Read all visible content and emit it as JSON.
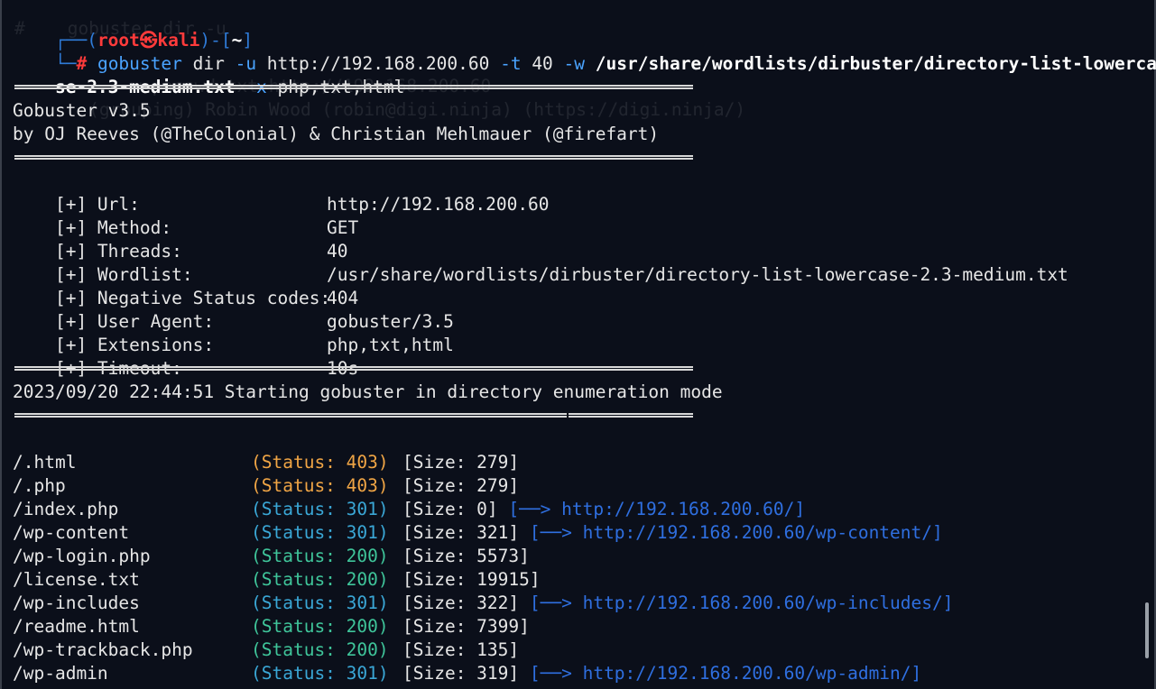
{
  "prompt": {
    "frame_top_open": "┌──(",
    "user": "root㉿kali",
    "frame_mid": ")-[",
    "cwd": "~",
    "frame_top_close": "]",
    "frame_bottom": "└─",
    "hash": "#",
    "command_name": "gobuster",
    "subcommand": " dir ",
    "flag_u": "-u",
    "url_arg": " http://192.168.200.60 ",
    "flag_t": "-t",
    "threads_arg": " 40 ",
    "flag_w": "-w",
    "wordlist_arg_part1": " /usr/share/wordlists/dirbuster/directory-list-lowerca",
    "wordlist_arg_part2": "se-2.3-medium.txt",
    "flag_x": " -x",
    "ext_arg": " php,txt,html"
  },
  "ghost_text": {
    "line1": "#    gobuster dir -u",
    "line2": "          -w passwd.txt http://192.168.200.60",
    "line3": "       (grouping) Robin Wood (robin@digi.ninja) (https://digi.ninja/)"
  },
  "banner": {
    "title": "Gobuster v3.5",
    "credits": "by OJ Reeves (@TheColonial) & Christian Mehlmauer (@firefart)"
  },
  "config": [
    {
      "key": "[+] Url:",
      "value": "http://192.168.200.60"
    },
    {
      "key": "[+] Method:",
      "value": "GET"
    },
    {
      "key": "[+] Threads:",
      "value": "40"
    },
    {
      "key": "[+] Wordlist:",
      "value": "/usr/share/wordlists/dirbuster/directory-list-lowercase-2.3-medium.txt"
    },
    {
      "key": "[+] Negative Status codes:",
      "value": "404"
    },
    {
      "key": "[+] User Agent:",
      "value": "gobuster/3.5"
    },
    {
      "key": "[+] Extensions:",
      "value": "php,txt,html"
    },
    {
      "key": "[+] Timeout:",
      "value": "10s"
    }
  ],
  "start_message": "2023/09/20 22:44:51 Starting gobuster in directory enumeration mode",
  "results": [
    {
      "path": "/.html",
      "status": "(Status: 403)",
      "size": "[Size: 279]",
      "redirect": ""
    },
    {
      "path": "/.php",
      "status": "(Status: 403)",
      "size": "[Size: 279]",
      "redirect": ""
    },
    {
      "path": "/index.php",
      "status": "(Status: 301)",
      "size": "[Size: 0]",
      "redirect": "[──> http://192.168.200.60/]"
    },
    {
      "path": "/wp-content",
      "status": "(Status: 301)",
      "size": "[Size: 321]",
      "redirect": "[──> http://192.168.200.60/wp-content/]"
    },
    {
      "path": "/wp-login.php",
      "status": "(Status: 200)",
      "size": "[Size: 5573]",
      "redirect": ""
    },
    {
      "path": "/license.txt",
      "status": "(Status: 200)",
      "size": "[Size: 19915]",
      "redirect": ""
    },
    {
      "path": "/wp-includes",
      "status": "(Status: 301)",
      "size": "[Size: 322]",
      "redirect": "[──> http://192.168.200.60/wp-includes/]"
    },
    {
      "path": "/readme.html",
      "status": "(Status: 200)",
      "size": "[Size: 7399]",
      "redirect": ""
    },
    {
      "path": "/wp-trackback.php",
      "status": "(Status: 200)",
      "size": "[Size: 135]",
      "redirect": ""
    },
    {
      "path": "/wp-admin",
      "status": "(Status: 301)",
      "size": "[Size: 319]",
      "redirect": "[──> http://192.168.200.60/wp-admin/]"
    }
  ],
  "colors": {
    "background": "#0b0f1a",
    "status_403": "#f0a545",
    "status_301": "#3aa7d6",
    "status_200": "#3fc59a",
    "redirect": "#2f6fe0",
    "prompt_user": "#ff3b3b",
    "prompt_frame": "#2f7bd8"
  }
}
